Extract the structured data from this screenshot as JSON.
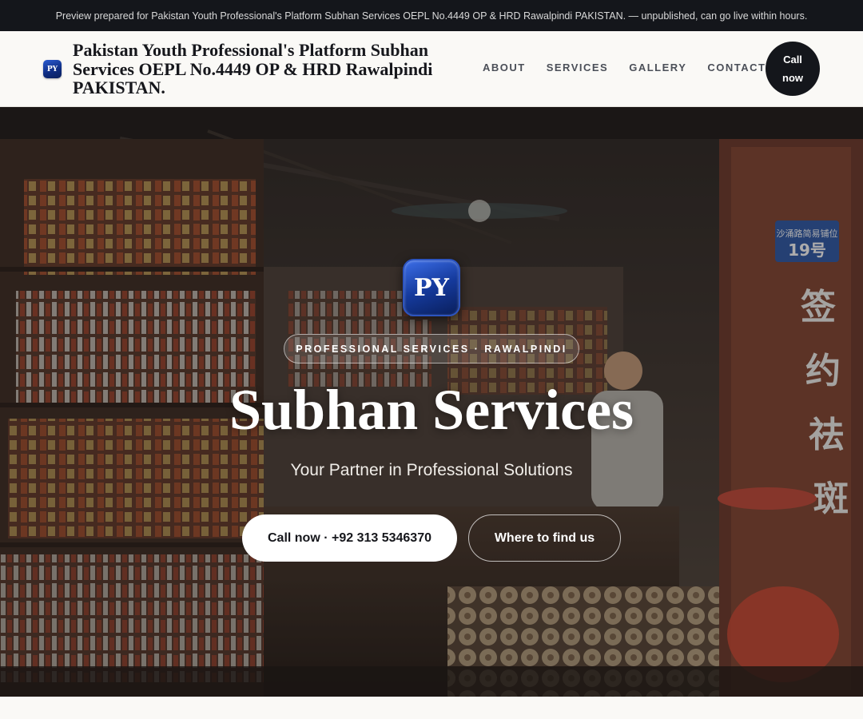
{
  "preview_banner": "Preview prepared for Pakistan Youth Professional's Platform Subhan Services OEPL No.4449 OP & HRD Rawalpindi PAKISTAN. — unpublished, can go live within hours.",
  "header": {
    "logo_text": "PY",
    "brand_name": "Pakistan Youth Professional's Platform Subhan Services OEPL No.4449 OP & HRD Rawalpindi PAKISTAN.",
    "nav": [
      "ABOUT",
      "SERVICES",
      "GALLERY",
      "CONTACT"
    ],
    "call_button": "Call now"
  },
  "hero": {
    "logo_text": "PY",
    "tagline": "PROFESSIONAL SERVICES · RAWALPINDI",
    "title": "Subhan Services",
    "subtitle": "Your Partner in Professional Solutions",
    "primary_cta": "Call now · +92 313 5346370",
    "secondary_cta": "Where to find us",
    "sign_text": [
      "沙涌路简易铺位",
      "19号",
      "签",
      "约",
      "祛",
      "斑"
    ]
  },
  "colors": {
    "dark": "#14161b",
    "brand_blue": "#153a9c",
    "background": "#faf9f6"
  }
}
